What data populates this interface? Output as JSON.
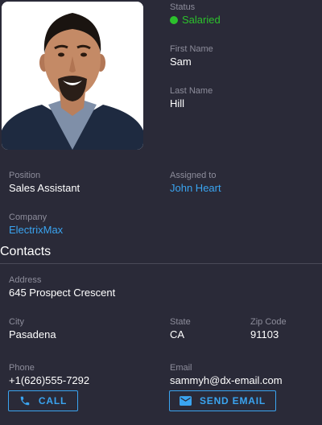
{
  "status": {
    "label": "Status",
    "value": "Salaried",
    "color": "#2cc12c"
  },
  "first_name": {
    "label": "First Name",
    "value": "Sam"
  },
  "last_name": {
    "label": "Last Name",
    "value": "Hill"
  },
  "position": {
    "label": "Position",
    "value": "Sales Assistant"
  },
  "assigned_to": {
    "label": "Assigned to",
    "value": "John Heart"
  },
  "company": {
    "label": "Company",
    "value": "ElectrixMax"
  },
  "contacts": {
    "title": "Contacts",
    "address": {
      "label": "Address",
      "value": "645 Prospect Crescent"
    },
    "city": {
      "label": "City",
      "value": "Pasadena"
    },
    "state": {
      "label": "State",
      "value": "CA"
    },
    "zip": {
      "label": "Zip Code",
      "value": "91103"
    },
    "phone": {
      "label": "Phone",
      "value": "+1(626)555-7292"
    },
    "email": {
      "label": "Email",
      "value": "sammyh@dx-email.com"
    }
  },
  "actions": {
    "call_label": "CALL",
    "call_icon": "phone-icon",
    "email_label": "SEND EMAIL",
    "email_icon": "envelope-icon"
  },
  "colors": {
    "background": "#2a2a38",
    "accent": "#3aa4f0",
    "muted": "#8d8d9b"
  }
}
